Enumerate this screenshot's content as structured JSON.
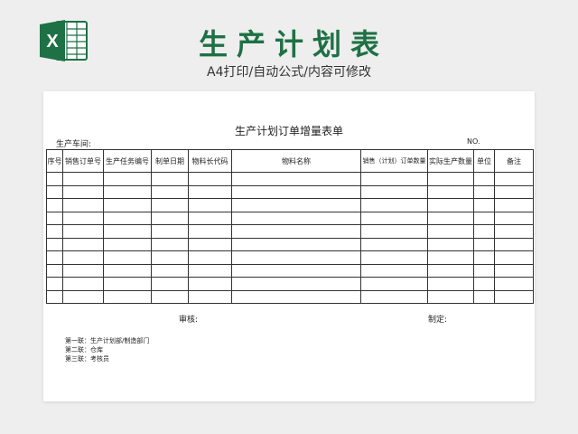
{
  "banner": {
    "title": "生产计划表",
    "subtitle": "A4打印/自动公式/内容可修改",
    "brand_color": "#1e7145"
  },
  "icons": {
    "logo": "excel-icon",
    "logo_letter": "X"
  },
  "document": {
    "title": "生产计划订单增量表单",
    "workshop_label": "生产车间:",
    "no_label": "NO.",
    "columns": [
      "序号",
      "销售订单号",
      "生产任务编号",
      "制单日期",
      "物料长代码",
      "物料名称",
      "销售（计划）订单数量",
      "实际生产数量",
      "单位",
      "备注"
    ],
    "row_count": 10,
    "review_label": "审核:",
    "make_label": "制定:",
    "copies": [
      "第一联：生产计划部/制造部门",
      "第二联：仓库",
      "第三联：考核员"
    ]
  }
}
